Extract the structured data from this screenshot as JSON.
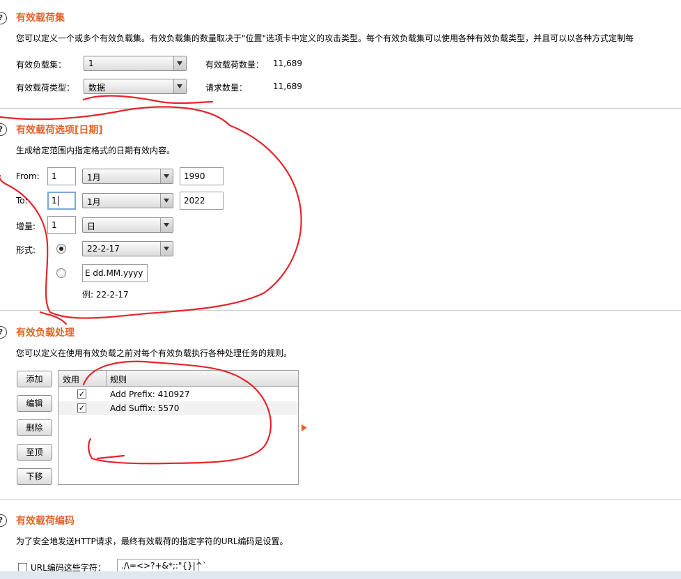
{
  "payload_sets": {
    "title": "有效载荷集",
    "description": "您可以定义一个或多个有效负载集。有效负载集的数量取决于\"位置\"选项卡中定义的攻击类型。每个有效负载集可以使用各种有效负载类型，并且可以以各种方式定制每",
    "set_label": "有效负载集：",
    "set_value": "1",
    "type_label": "有效载荷类型：",
    "type_value": "数据",
    "count_label": "有效载荷数量：",
    "count_value": "11,689",
    "request_label": "请求数量：",
    "request_value": "11,689"
  },
  "payload_options": {
    "title": "有效载荷选项[日期]",
    "description": "生成给定范围内指定格式的日期有效内容。",
    "from_label": "From:",
    "from_day": "1",
    "from_month": "1月",
    "from_year": "1990",
    "to_label": "To:",
    "to_day": "1",
    "to_month": "1月",
    "to_year": "2022",
    "step_label": "增量:",
    "step_value": "1",
    "step_unit": "日",
    "format_label": "形式:",
    "format_preset": "22-2-17",
    "format_custom": "E dd.MM.yyyy",
    "example": "例: 22-2-17"
  },
  "payload_processing": {
    "title": "有效负载处理",
    "description": "您可以定义在使用有效负载之前对每个有效负载执行各种处理任务的规则。",
    "buttons": [
      "添加",
      "编辑",
      "删除",
      "至顶",
      "下移"
    ],
    "columns": [
      "效用",
      "规则"
    ],
    "rows": [
      {
        "enabled": true,
        "rule": "Add Prefix: 410927"
      },
      {
        "enabled": true,
        "rule": "Add Suffix: 5570"
      }
    ]
  },
  "payload_encoding": {
    "title": "有效载荷编码",
    "description": "为了安全地发送HTTP请求，最终有效载荷的指定字符的URL编码是设置。",
    "url_encode_label": "URL编码这些字符：",
    "url_encode_chars": "./\\=<>?+&*;:\"{}|^`"
  },
  "icons": {
    "help": "?",
    "check": "✓"
  },
  "colors": {
    "title": "#e2652b",
    "ink": "#e8232a"
  }
}
